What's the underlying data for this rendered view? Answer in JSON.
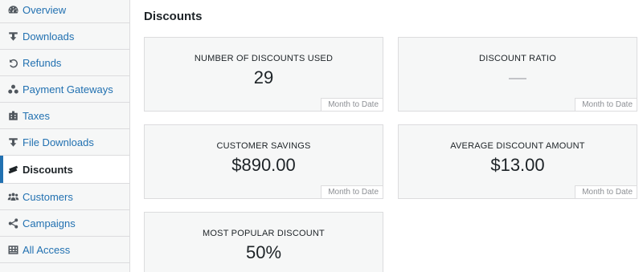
{
  "sidebar": {
    "items": [
      {
        "label": "Overview",
        "icon": "dashboard-icon"
      },
      {
        "label": "Downloads",
        "icon": "download-icon"
      },
      {
        "label": "Refunds",
        "icon": "undo-icon"
      },
      {
        "label": "Payment Gateways",
        "icon": "groups-icon"
      },
      {
        "label": "Taxes",
        "icon": "building-icon"
      },
      {
        "label": "File Downloads",
        "icon": "download-icon"
      },
      {
        "label": "Discounts",
        "icon": "tickets-icon"
      },
      {
        "label": "Customers",
        "icon": "customers-icon"
      },
      {
        "label": "Campaigns",
        "icon": "share-icon"
      },
      {
        "label": "All Access",
        "icon": "grid-icon"
      }
    ],
    "active": "Discounts"
  },
  "main": {
    "title": "Discounts",
    "tiles": [
      {
        "label": "NUMBER OF DISCOUNTS USED",
        "value": "29",
        "period": "Month to Date"
      },
      {
        "label": "DISCOUNT RATIO",
        "value": "—",
        "period": "Month to Date"
      },
      {
        "label": "CUSTOMER SAVINGS",
        "value": "$890.00",
        "period": "Month to Date"
      },
      {
        "label": "AVERAGE DISCOUNT AMOUNT",
        "value": "$13.00",
        "period": "Month to Date"
      },
      {
        "label": "MOST POPULAR DISCOUNT",
        "value": "50%",
        "period": ""
      }
    ]
  },
  "colors": {
    "link": "#2271b1",
    "active_bar": "#2271b1",
    "tile_bg": "#f6f7f7",
    "border": "#dcdcde"
  }
}
